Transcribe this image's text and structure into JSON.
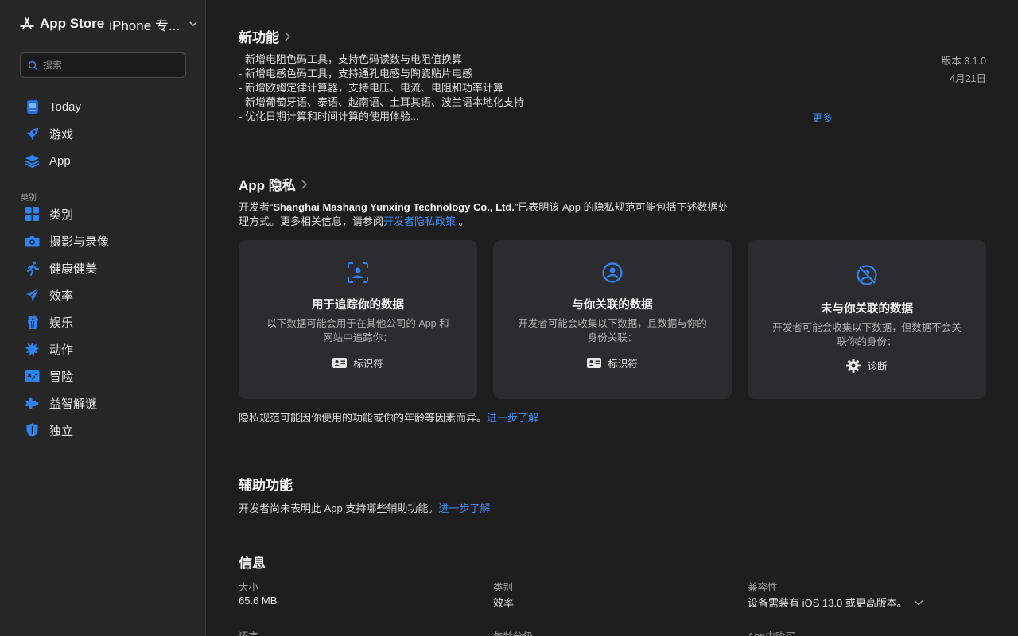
{
  "sidebar": {
    "store_title_bold": "App Store",
    "store_title_rest": "iPhone 专...",
    "search_placeholder": "搜索",
    "items": [
      {
        "label": "Today"
      },
      {
        "label": "游戏"
      },
      {
        "label": "App"
      }
    ],
    "category_section": "类别",
    "categories": [
      {
        "label": "类别"
      },
      {
        "label": "摄影与录像"
      },
      {
        "label": "健康健美"
      },
      {
        "label": "效率"
      },
      {
        "label": "娱乐"
      },
      {
        "label": "动作"
      },
      {
        "label": "冒险"
      },
      {
        "label": "益智解谜"
      },
      {
        "label": "独立"
      }
    ]
  },
  "whats_new": {
    "title": "新功能",
    "items": [
      "- 新增电阻色码工具，支持色码读数与电阻值换算",
      "- 新增电感色码工具，支持通孔电感与陶瓷贴片电感",
      "- 新增欧姆定律计算器，支持电压、电流、电阻和功率计算",
      "- 新增葡萄牙语、泰语、越南语、土耳其语、波兰语本地化支持",
      "- 优化日期计算和时间计算的使用体验..."
    ],
    "version": "版本 3.1.0",
    "date": "4月21日",
    "more": "更多"
  },
  "privacy": {
    "title": "App 隐私",
    "text_prefix": "开发者“",
    "developer": "Shanghai Mashang Yunxing Technology Co., Ltd.",
    "text_middle": "”已表明该 App 的隐私规范可能包括下述数据处理方式。更多相关信息，请参阅",
    "policy_link": "开发者隐私政策",
    "text_suffix": " 。",
    "cards": [
      {
        "title": "用于追踪你的数据",
        "desc": "以下数据可能会用于在其他公司的 App 和网站中追踪你：",
        "tag": "标识符"
      },
      {
        "title": "与你关联的数据",
        "desc": "开发者可能会收集以下数据，且数据与你的身份关联：",
        "tag": "标识符"
      },
      {
        "title": "未与你关联的数据",
        "desc": "开发者可能会收集以下数据，但数据不会关联你的身份：",
        "tag": "诊断"
      }
    ],
    "note": "隐私规范可能因你使用的功能或你的年龄等因素而异。",
    "note_link": "进一步了解"
  },
  "accessibility": {
    "title": "辅助功能",
    "text": "开发者尚未表明此 App 支持哪些辅助功能。",
    "link": "进一步了解"
  },
  "info": {
    "title": "信息",
    "size_label": "大小",
    "size_value": "65.6 MB",
    "category_label": "类别",
    "category_value": "效率",
    "compat_label": "兼容性",
    "compat_value": "设备需装有 iOS 13.0 或更高版本。",
    "language_label": "语言",
    "age_label": "年龄分级",
    "iap_label": "App内购买"
  },
  "colors": {
    "accent": "#3b8cf5",
    "card_bg": "#2c2c2e",
    "sidebar_bg": "#262626"
  }
}
